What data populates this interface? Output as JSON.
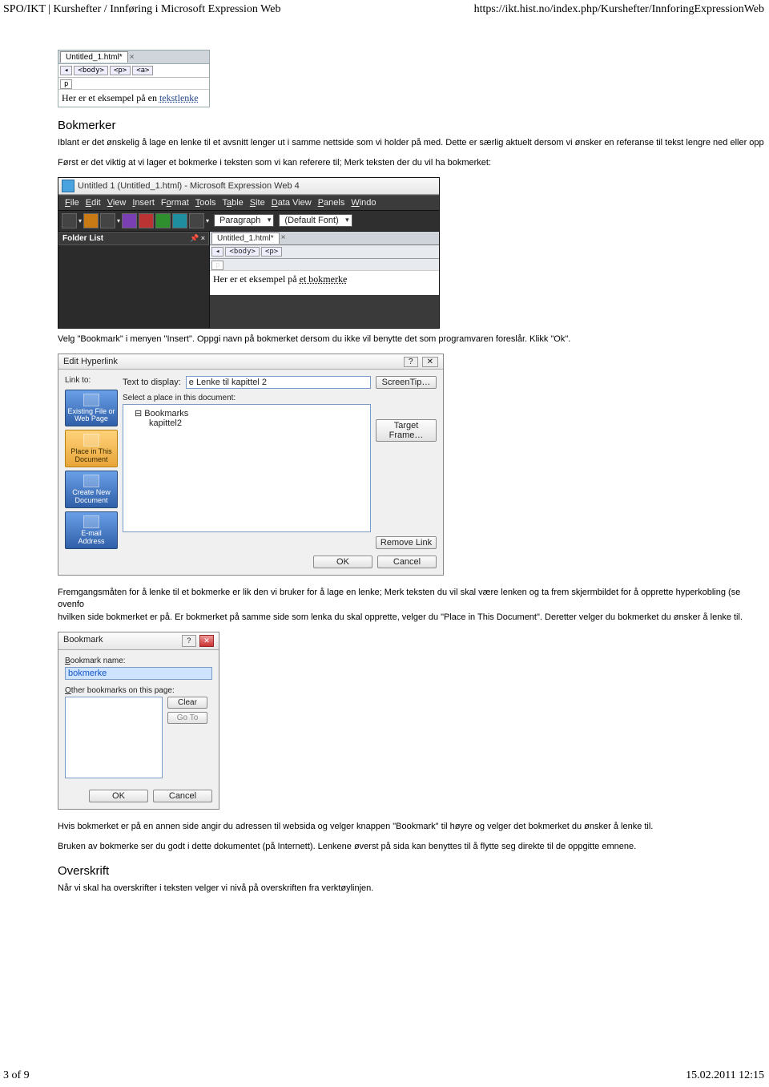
{
  "header": {
    "left": "SPO/IKT | Kurshefter / Innføring i Microsoft Expression Web",
    "right": "https://ikt.hist.no/index.php/Kurshefter/InnforingExpressionWeb"
  },
  "fig1": {
    "tab": "Untitled_1.html*",
    "close": "×",
    "crumb_arrow": "◂",
    "crumb_body": "<body>",
    "crumb_p": "<p>",
    "crumb_a": "<a>",
    "p_crumb": "p",
    "text_pre": "Her er et eksempel på en ",
    "text_link": "tekstlenke"
  },
  "section1": {
    "heading": "Bokmerker",
    "p1": "Iblant er det ønskelig å lage en lenke til et avsnitt lenger ut i samme nettside som vi holder på med. Dette er særlig aktuelt dersom vi ønsker en referanse til tekst lengre ned eller opp",
    "p2": "Først er det viktig at vi lager et bokmerke i teksten som vi kan referere til; Merk teksten der du vil ha bokmerket:"
  },
  "fig2": {
    "title": "Untitled 1 (Untitled_1.html) - Microsoft Expression Web 4",
    "menu": {
      "file": "File",
      "edit": "Edit",
      "view": "View",
      "insert": "Insert",
      "format": "Format",
      "tools": "Tools",
      "table": "Table",
      "site": "Site",
      "dataview": "Data View",
      "panels": "Panels",
      "windo": "Windo"
    },
    "dd_paragraph": "Paragraph",
    "dd_font": "(Default Font)",
    "folder_header": "Folder List",
    "pin": "📌 ×",
    "tab": "Untitled_1.html*",
    "crumb_arrow": "◂",
    "crumb_body": "<body>",
    "crumb_p": "<p>",
    "p_crumb": "p",
    "text_pre": "Her er et eksempel på  ",
    "text_mark": "et bokmerke"
  },
  "section2": {
    "p1": "Velg \"Bookmark\" i menyen \"Insert\". Oppgi navn på bokmerket dersom du ikke vil benytte det som programvaren foreslår. Klikk \"Ok\"."
  },
  "fig3": {
    "title": "Edit Hyperlink",
    "linkto": "Link to:",
    "ttd_label": "Text to display:",
    "ttd_value": "e Lenke til kapittel 2",
    "screen_tip": "ScreenTip…",
    "select_label": "Select a place in this document:",
    "tree_root": "⊟ Bookmarks",
    "tree_child": "kapittel2",
    "side": {
      "existing": "Existing File or Web Page",
      "place": "Place in This Document",
      "create": "Create New Document",
      "email": "E-mail Address"
    },
    "target_frame": "Target Frame…",
    "remove": "Remove Link",
    "ok": "OK",
    "cancel": "Cancel"
  },
  "section3": {
    "p1": "Fremgangsmåten for å lenke til et bokmerke er lik den vi bruker for å lage en lenke; Merk teksten du vil skal være lenken og ta frem skjermbildet for å opprette hyperkobling (se ovenfo",
    "p2_a": "hvilken side bokmerket er på. Er bokmerket på samme side som lenka du skal opprette, velger du \"Place in This Document\". Deretter velger du bokmerket du ønsker å lenke til."
  },
  "fig4": {
    "title": "Bookmark",
    "name_label": "Bookmark name:",
    "name_value": "bokmerke",
    "other_label": "Other bookmarks on this page:",
    "clear": "Clear",
    "goto": "Go To",
    "ok": "OK",
    "cancel": "Cancel"
  },
  "section4": {
    "p1": "Hvis bokmerket er på en annen side angir du adressen til websida og velger knappen \"Bookmark\" til høyre og velger det bokmerket du ønsker å lenke til.",
    "p2": "Bruken av bokmerke ser du godt i dette dokumentet (på Internett). Lenkene øverst på sida kan benyttes til å flytte seg direkte til de oppgitte emnene.",
    "heading": "Overskrift",
    "p3": "Når vi skal ha overskrifter i teksten velger vi nivå på overskriften fra verktøylinjen."
  },
  "footer": {
    "left": "3 of 9",
    "right": "15.02.2011 12:15"
  }
}
